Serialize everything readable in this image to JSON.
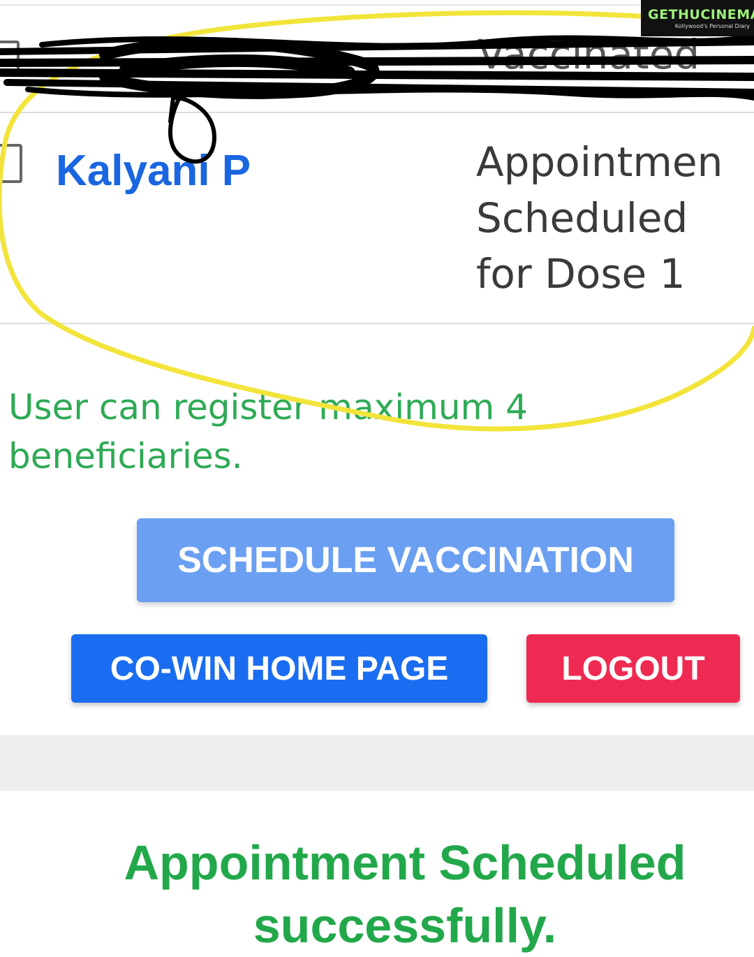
{
  "beneficiaries": [
    {
      "name": "",
      "status": "Vaccinated",
      "redacted": true
    },
    {
      "name": "Kalyani P",
      "status_lines": [
        "Appointmen",
        "Scheduled",
        "for Dose 1"
      ],
      "redacted": false
    }
  ],
  "info_message": "User can register maximum 4 beneficiaries.",
  "buttons": {
    "schedule": "SCHEDULE VACCINATION",
    "home": "CO-WIN HOME PAGE",
    "logout": "LOGOUT"
  },
  "success_message": "Appointment Scheduled successfully.",
  "watermark": {
    "title": "GETHUCINEMA",
    "subtitle": "Kollywood's Personal Diary"
  },
  "colors": {
    "name_link": "#1a66e0",
    "info_green": "#2eaa55",
    "schedule_button": "#6b9ff2",
    "home_button": "#1a6df0",
    "logout_button": "#ee2a52",
    "success_green": "#22a84a",
    "annotation_yellow": "#f2e43a",
    "scribble": "#000000"
  },
  "icons": [
    "checkbox-icon",
    "scribble-redaction",
    "yellow-circle-annotation"
  ]
}
